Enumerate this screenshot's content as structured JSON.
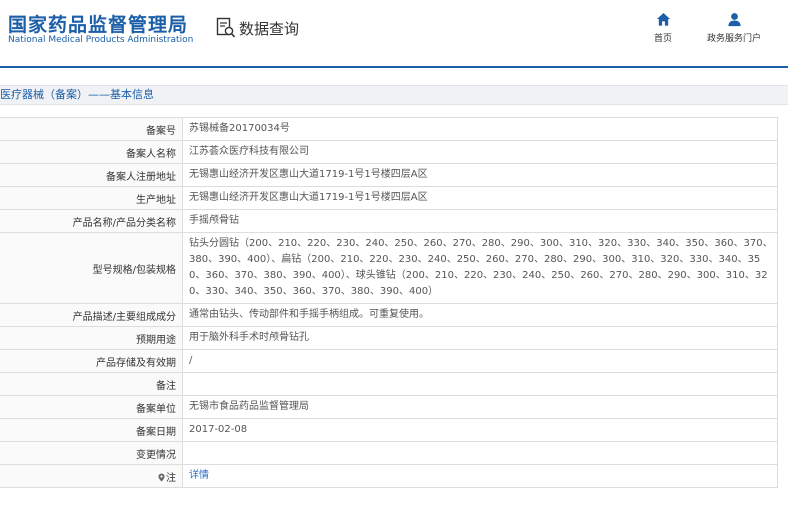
{
  "header": {
    "logo_cn": "国家药品监督管理局",
    "logo_en": "National Medical Products Administration",
    "query_label": "数据查询",
    "nav": [
      {
        "label": "首页",
        "icon": "home-icon"
      },
      {
        "label": "政务服务门户",
        "icon": "user-icon"
      }
    ],
    "brand_color": "#1c5ea8"
  },
  "section": {
    "title": "医疗器械（备案）——基本信息"
  },
  "rows": [
    {
      "label": "备案号",
      "value": "苏锡械备20170034号"
    },
    {
      "label": "备案人名称",
      "value": "江苏荟众医疗科技有限公司"
    },
    {
      "label": "备案人注册地址",
      "value": "无锡惠山经济开发区惠山大道1719-1号1号楼四层A区"
    },
    {
      "label": "生产地址",
      "value": "无锡惠山经济开发区惠山大道1719-1号1号楼四层A区"
    },
    {
      "label": "产品名称/产品分类名称",
      "value": "手摇颅骨钻"
    },
    {
      "label": "型号规格/包装规格",
      "value": "钻头分圆钻（200、210、220、230、240、250、260、270、280、290、300、310、320、330、340、350、360、370、380、390、400）、扁钻（200、210、220、230、240、250、260、270、280、290、300、310、320、330、340、350、360、370、380、390、400）、球头锥钻（200、210、220、230、240、250、260、270、280、290、300、310、320、330、340、350、360、370、380、390、400）"
    },
    {
      "label": "产品描述/主要组成成分",
      "value": "通常由钻头、传动部件和手摇手柄组成。可重复使用。"
    },
    {
      "label": "预期用途",
      "value": "用于脑外科手术时颅骨钻孔"
    },
    {
      "label": "产品存储及有效期",
      "value": "/"
    },
    {
      "label": "备注",
      "value": ""
    },
    {
      "label": "备案单位",
      "value": "无锡市食品药品监督管理局"
    },
    {
      "label": "备案日期",
      "value": "2017-02-08"
    },
    {
      "label": "变更情况",
      "value": ""
    },
    {
      "label": "注",
      "value": "详情"
    }
  ]
}
